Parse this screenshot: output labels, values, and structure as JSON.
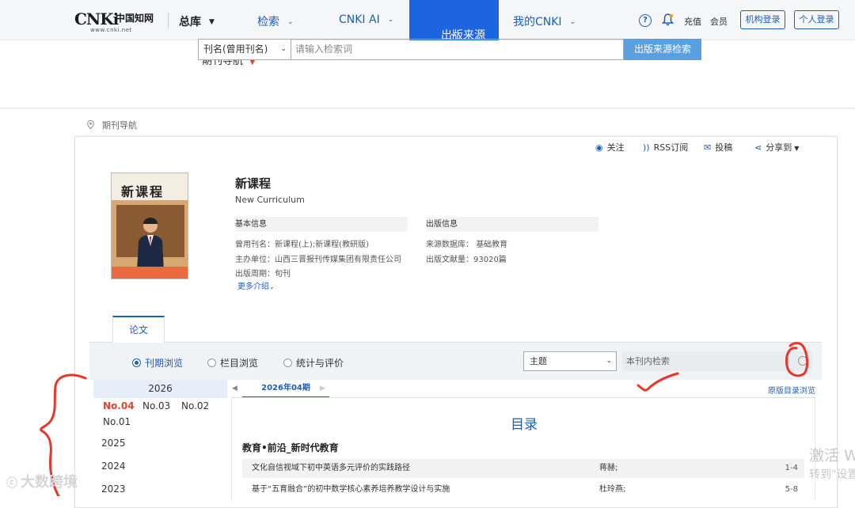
{
  "topnav": {
    "logo_text": "CNKi",
    "logo_cn": "中国知网",
    "logo_url": "www.cnki.net",
    "library": "总库",
    "items": [
      {
        "label": "检索"
      },
      {
        "label": "CNKI AI"
      },
      {
        "label": "出版来源"
      },
      {
        "label": "我的CNKI"
      }
    ],
    "help": "?",
    "recharge": "充值",
    "member": "会员",
    "inst_login": "机构登录",
    "personal_login": "个人登录"
  },
  "search": {
    "nav_label": "期刊导航",
    "field": "刊名(曾用刊名)",
    "placeholder": "请输入检索词",
    "button": "出版来源检索"
  },
  "breadcrumb": "期刊导航",
  "toolbar": {
    "follow": "关注",
    "rss": "RSS订阅",
    "submit": "投稿",
    "share": "分享到"
  },
  "cover": {
    "title": "新课程"
  },
  "journal": {
    "title": "新课程",
    "english": "New Curriculum",
    "basic_head": "基本信息",
    "pub_head": "出版信息",
    "former_label": "曾用刊名：",
    "former_value": "新课程(上);新课程(教研版)",
    "sponsor_label": "主办单位：",
    "sponsor_value": "山西三晋报刊传媒集团有限责任公司",
    "cycle_label": "出版周期：",
    "cycle_value": "旬刊",
    "db_label": "来源数据库：",
    "db_value": "基础教育",
    "count_label": "出版文献量：",
    "count_value": "93020篇",
    "more": "更多介绍"
  },
  "tabs": {
    "paper": "论文"
  },
  "browse": {
    "by_issue": "刊期浏览",
    "by_column": "栏目浏览",
    "stats": "统计与评价",
    "topic": "主题",
    "inner_placeholder": "本刊内检索"
  },
  "years": {
    "current": "2026",
    "issues": [
      "No.04",
      "No.03",
      "No.02",
      "No.01"
    ],
    "others": [
      "2025",
      "2024",
      "2023"
    ]
  },
  "issue": {
    "tab": "2026年04期",
    "orig_toc": "原版目录浏览",
    "toc_title": "目录",
    "section": "教育•前沿_新时代教育",
    "articles": [
      {
        "title": "文化自信视域下初中英语多元评价的实践路径",
        "author": "蒋赫;",
        "pages": "1-4"
      },
      {
        "title": "基于“五育融合”的初中数学核心素养培养教学设计与实施",
        "author": "杜玲燕;",
        "pages": "5-8"
      }
    ]
  },
  "watermarks": {
    "activate": "激活 W",
    "settings": "转到\"设置",
    "brand": "大数跨境"
  },
  "colors": {
    "brand_blue": "#1c64e0",
    "link_blue": "#1c5fb7",
    "accent_red": "#e0452d",
    "annotation_red": "#e8372a"
  }
}
